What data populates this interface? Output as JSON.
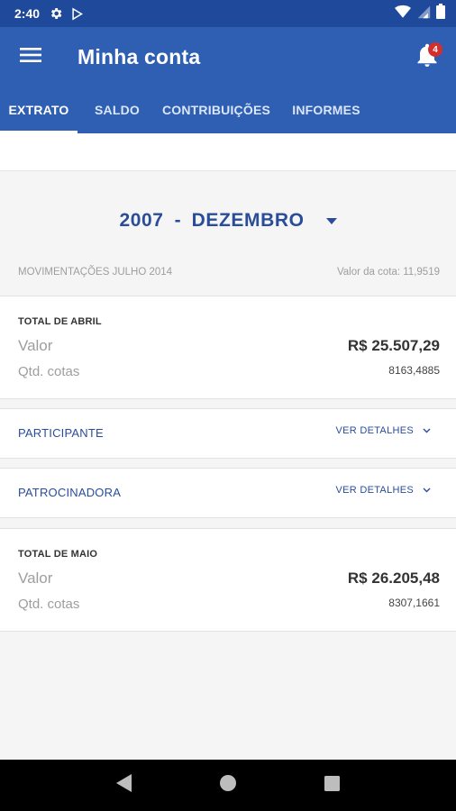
{
  "status_bar": {
    "time": "2:40",
    "icons": [
      "gear-icon",
      "play-store-icon",
      "wifi-icon",
      "signal-icon",
      "battery-icon"
    ]
  },
  "app_bar": {
    "title": "Minha conta",
    "notification_count": "4",
    "icons": [
      "menu-icon",
      "bell-icon"
    ]
  },
  "tabs": [
    {
      "label": "EXTRATO",
      "active": true
    },
    {
      "label": "SALDO",
      "active": false
    },
    {
      "label": "CONTRIBUIÇÕES",
      "active": false
    },
    {
      "label": "INFORMES",
      "active": false
    }
  ],
  "period": {
    "year": "2007",
    "separator": "-",
    "month": "DEZEMBRO"
  },
  "movements": {
    "label": "MOVIMENTAÇÕES JULHO 2014",
    "quota_value": "Valor da cota: 11,9519"
  },
  "total_first": {
    "title": "TOTAL DE ABRIL",
    "value_label": "Valor",
    "value": "R$ 25.507,29",
    "quotas_label": "Qtd. cotas",
    "quotas": "8163,4885"
  },
  "sections": [
    {
      "label": "PARTICIPANTE",
      "action": "VER DETALHES"
    },
    {
      "label": "PATROCINADORA",
      "action": "VER DETALHES"
    }
  ],
  "total_second": {
    "title": "TOTAL DE MAIO",
    "value_label": "Valor",
    "value": "R$ 26.205,48",
    "quotas_label": "Qtd. cotas",
    "quotas": "8307,1661"
  },
  "colors": {
    "status_bar": "#1f4a9c",
    "app_bar": "#2f5fb3",
    "accent_text": "#2a4d9a",
    "badge": "#d32f2f"
  }
}
